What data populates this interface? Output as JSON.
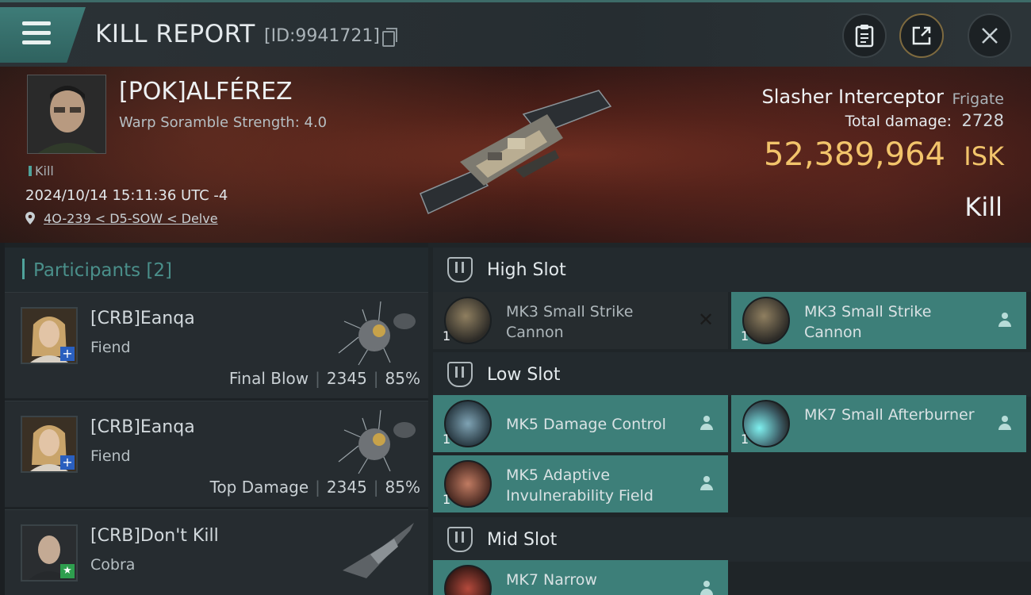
{
  "header": {
    "title": "KILL REPORT",
    "report_id": "[ID:9941721]"
  },
  "victim": {
    "name": "[POK]ALFÉREZ",
    "warp_scramble": "Warp Soramble Strength: 4.0",
    "tag": "Kill",
    "datetime": "2024/10/14 15:11:36 UTC -4",
    "location": "4O-239 < D5-SOW < Delve",
    "ship_name": "Slasher Interceptor",
    "ship_class": "Frigate",
    "total_damage_label": "Total damage:",
    "total_damage": "2728",
    "isk_value": "52,389,964",
    "isk_unit": "ISK",
    "kill_type": "Kill"
  },
  "participants": {
    "label": "Participants",
    "count": "[2]",
    "rows": [
      {
        "name": "[CRB]Eanqa",
        "ship": "Fiend",
        "role": "Final Blow",
        "damage": "2345",
        "percent": "85%",
        "badge": "+"
      },
      {
        "name": "[CRB]Eanqa",
        "ship": "Fiend",
        "role": "Top Damage",
        "damage": "2345",
        "percent": "85%",
        "badge": "+"
      },
      {
        "name": "[CRB]Don't Kill",
        "ship": "Cobra",
        "role": "",
        "damage": "",
        "percent": "",
        "badge": "★"
      }
    ]
  },
  "slots": {
    "high": {
      "label": "High Slot",
      "modules": [
        {
          "name": "MK3 Small Strike Cannon",
          "qty": "1",
          "status": "destroyed"
        },
        {
          "name": "MK3 Small Strike Cannon",
          "qty": "1",
          "status": "dropped"
        }
      ]
    },
    "low": {
      "label": "Low Slot",
      "modules": [
        {
          "name": "MK5 Damage Control",
          "qty": "1",
          "status": "dropped"
        },
        {
          "name": "MK7 Small Afterburner",
          "qty": "1",
          "status": "dropped"
        },
        {
          "name": "MK5 Adaptive Invulnerability Field",
          "qty": "1",
          "status": "dropped"
        }
      ]
    },
    "mid": {
      "label": "Mid Slot",
      "modules": [
        {
          "name": "MK7 Narrow",
          "qty": "",
          "status": "dropped"
        }
      ]
    }
  },
  "colors": {
    "accent_teal": "#3d7f79",
    "isk_gold": "#f2c46b"
  }
}
